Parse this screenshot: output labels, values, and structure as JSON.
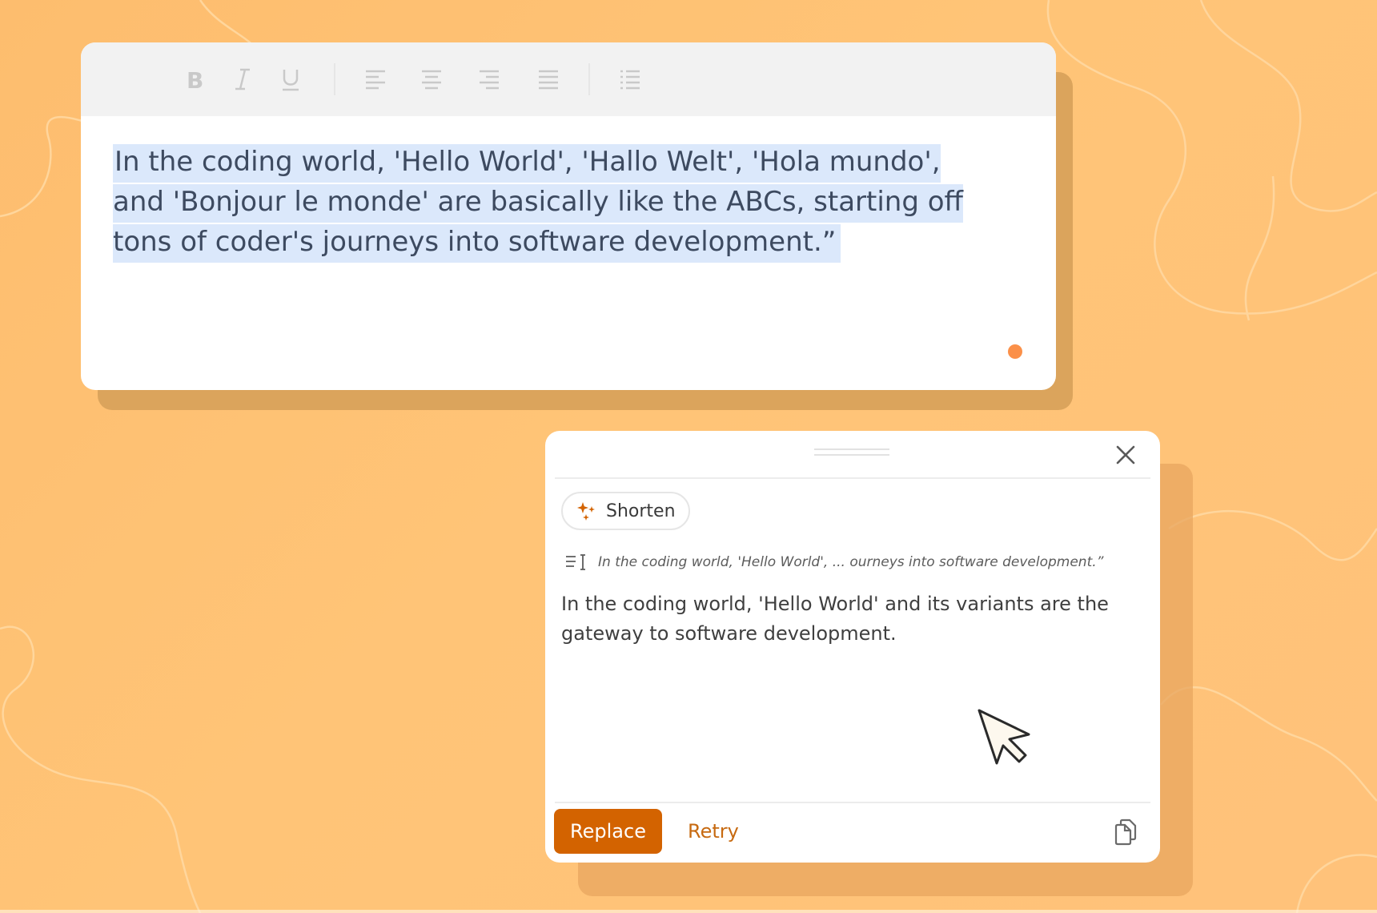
{
  "colors": {
    "accent": "#d36300",
    "highlight": "#dbe8fb",
    "status_dot": "#fb9049"
  },
  "editor": {
    "toolbar": {
      "icons": [
        "bold-icon",
        "italic-icon",
        "underline-icon",
        "align-left-icon",
        "align-center-icon",
        "align-right-icon",
        "align-justify-icon",
        "list-icon"
      ]
    },
    "selected_text": "In the coding world, 'Hello World', 'Hallo Welt', 'Hola mundo', and 'Bonjour le monde' are basically like the ABCs, starting off tons of coder's journeys into software development.”"
  },
  "panel": {
    "action_chip": {
      "icon": "sparkles-icon",
      "label": "Shorten"
    },
    "source": {
      "icon": "text-selection-icon",
      "excerpt": "In the coding world, 'Hello World', ... ourneys into software development.”"
    },
    "result": "In the coding world, 'Hello World' and its variants are the gateway to software development.",
    "buttons": {
      "replace": "Replace",
      "retry": "Retry"
    },
    "icons": {
      "close": "close-icon",
      "copy": "copy-icon",
      "pointer": "mouse-pointer-icon"
    }
  }
}
